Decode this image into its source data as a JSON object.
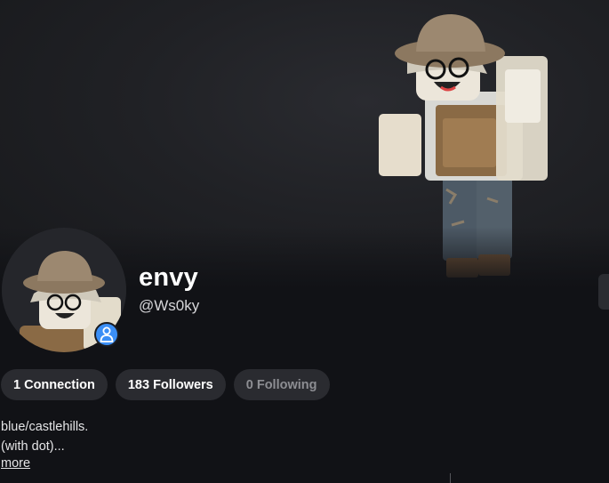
{
  "profile": {
    "display_name": "envy",
    "username": "@Ws0ky"
  },
  "stats": {
    "connections": "1 Connection",
    "followers": "183 Followers",
    "following": "0 Following"
  },
  "bio": {
    "line1": "blue/castlehills.",
    "line2": "(with dot)...",
    "more_label": "more"
  },
  "icons": {
    "presence": "person-icon"
  },
  "colors": {
    "background": "#111216",
    "pill": "#2a2b30",
    "presence_badge": "#3b8ff6",
    "muted_text": "#8d8e93"
  }
}
